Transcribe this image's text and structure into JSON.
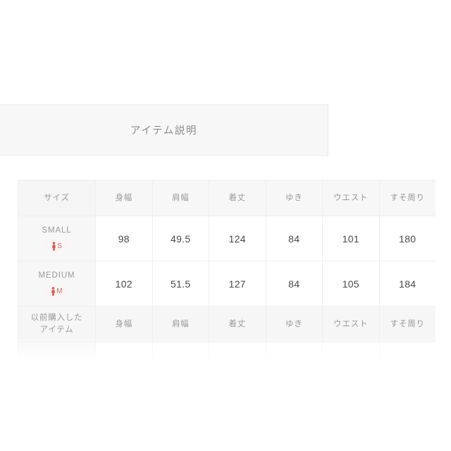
{
  "tab": {
    "label": "アイテム説明"
  },
  "size_table": {
    "columns": [
      "サイズ",
      "身幅",
      "肩幅",
      "着丈",
      "ゆき",
      "ウエスト",
      "すそ周り"
    ],
    "rows": [
      {
        "label": "SMALL",
        "badge_letter": "S",
        "badge_icon": "person-icon",
        "values": [
          "98",
          "49.5",
          "124",
          "84",
          "101",
          "180"
        ]
      },
      {
        "label": "MEDIUM",
        "badge_letter": "M",
        "badge_icon": "person-icon",
        "values": [
          "102",
          "51.5",
          "127",
          "84",
          "105",
          "184"
        ]
      }
    ],
    "second_header": {
      "label_line1": "以前購入した",
      "label_line2": "アイテム",
      "columns": [
        "身幅",
        "肩幅",
        "着丈",
        "ゆき",
        "ウエスト",
        "すそ周り"
      ]
    }
  },
  "colors": {
    "panel_background": "#f7f7f7",
    "header_text": "#9a9a9a",
    "value_text": "#4a4a4a",
    "badge_accent": "#c96a6a",
    "border": "#efefef"
  }
}
